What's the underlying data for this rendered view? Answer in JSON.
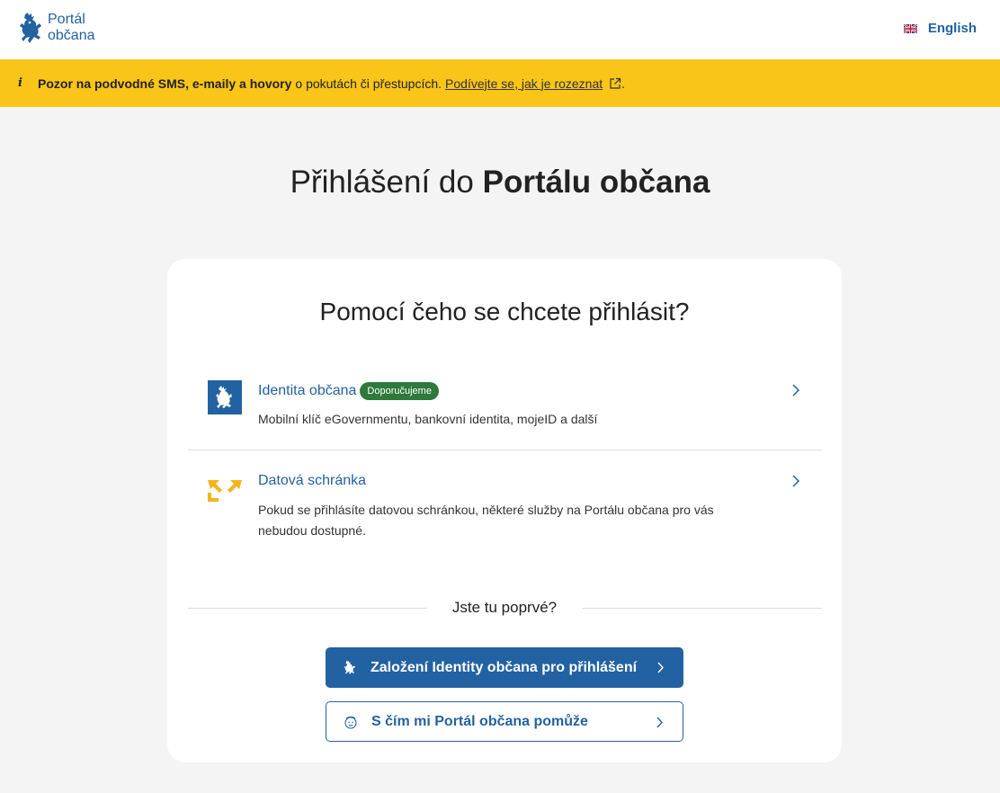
{
  "header": {
    "logo_line1": "Portál",
    "logo_line2": "občana",
    "language_label": "English",
    "logo_icon": "czech-lion-icon",
    "flag_icon": "uk-flag-icon"
  },
  "banner": {
    "bold_text": "Pozor na podvodné SMS, e-maily a hovory",
    "text": "o pokutách či přestupcích.",
    "link_text": "Podívejte se, jak je rozeznat",
    "trailing": ".",
    "info_glyph": "i",
    "background_color": "#f9c518"
  },
  "page": {
    "title_regular": "Přihlášení do",
    "title_bold": "Portálu občana"
  },
  "card": {
    "title": "Pomocí čeho se chcete přihlásit?",
    "options": [
      {
        "title": "Identita občana",
        "badge": "Doporučujeme",
        "description": "Mobilní klíč eGovernmentu, bankovní identita, mojeID a další",
        "icon": "identita-obcana-icon"
      },
      {
        "title": "Datová schránka",
        "description": "Pokud se přihlásíte datovou schránkou, některé služby na Portálu občana pro vás nebudou dostupné.",
        "icon": "datova-schranka-icon"
      }
    ],
    "first_time_label": "Jste tu poprvé?",
    "primary_button": "Založení Identity občana pro přihlášení",
    "secondary_button": "S čím mi Portál občana pomůže"
  },
  "colors": {
    "brand_blue": "#2362a2",
    "badge_green": "#2d7a3b",
    "ds_yellow": "#f4b51b"
  }
}
